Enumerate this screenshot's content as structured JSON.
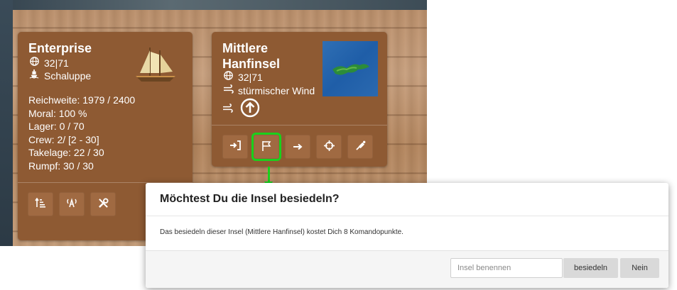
{
  "ship_card": {
    "name": "Enterprise",
    "coords": "32|71",
    "ship_type": "Schaluppe",
    "stats": [
      "Reichweite: 1979 / 2400",
      "Moral: 100 %",
      "Lager: 0 / 70",
      "Crew: 2/ [2 - 30]",
      "Takelage: 22 / 30",
      "Rumpf: 30 / 30"
    ],
    "actions": [
      {
        "icon": "sort-amount-up-icon"
      },
      {
        "icon": "broadcast-icon"
      },
      {
        "icon": "tools-icon"
      }
    ]
  },
  "island_card": {
    "name_line1": "Mittlere",
    "name_line2": "Hanfinsel",
    "coords": "32|71",
    "wind": "stürmischer Wind",
    "actions": [
      {
        "icon": "sign-in-icon"
      },
      {
        "icon": "flag-icon",
        "highlighted": true
      },
      {
        "icon": "arrow-right-icon"
      },
      {
        "icon": "crosshairs-icon"
      },
      {
        "icon": "spyglass-icon"
      }
    ]
  },
  "modal": {
    "title": "Möchtest Du die Insel besiedeln?",
    "body": "Das besiedeln dieser Insel (Mittlere Hanfinsel) kostet Dich 8 Komandopunkte.",
    "input_placeholder": "Insel benennen",
    "confirm_label": "besiedeln",
    "cancel_label": "Nein"
  },
  "colors": {
    "card": "#8e5a33",
    "highlight": "#19d11c"
  }
}
